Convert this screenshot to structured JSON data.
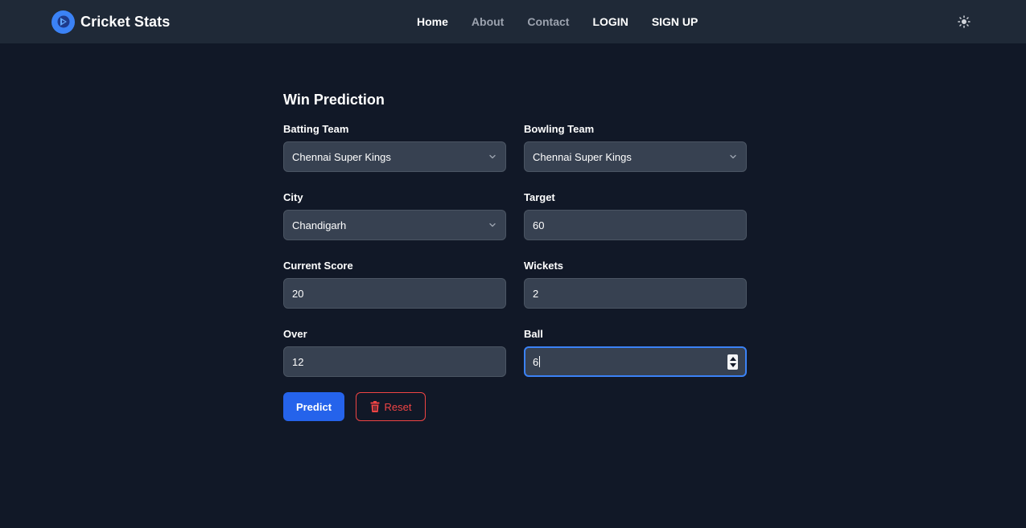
{
  "app": {
    "name": "Cricket Stats",
    "logo_icon": "logo-icon"
  },
  "nav": {
    "links": [
      {
        "label": "Home",
        "active": true
      },
      {
        "label": "About",
        "active": false
      },
      {
        "label": "Contact",
        "active": false
      },
      {
        "label": "LOGIN",
        "active": true
      },
      {
        "label": "SIGN UP",
        "active": true
      }
    ],
    "theme_icon": "sun-icon"
  },
  "form": {
    "title": "Win Prediction",
    "batting_team": {
      "label": "Batting Team",
      "value": "Chennai Super Kings"
    },
    "bowling_team": {
      "label": "Bowling Team",
      "value": "Chennai Super Kings"
    },
    "city": {
      "label": "City",
      "value": "Chandigarh"
    },
    "target": {
      "label": "Target",
      "value": "60"
    },
    "current_score": {
      "label": "Current Score",
      "value": "20"
    },
    "wickets": {
      "label": "Wickets",
      "value": "2"
    },
    "over": {
      "label": "Over",
      "value": "12"
    },
    "ball": {
      "label": "Ball",
      "value": "6"
    },
    "predict_label": "Predict",
    "reset_label": "Reset"
  },
  "colors": {
    "background": "#111827",
    "navbar": "#1f2937",
    "field": "#374151",
    "primary": "#2563eb",
    "danger": "#ef4444",
    "focus": "#3b82f6"
  }
}
